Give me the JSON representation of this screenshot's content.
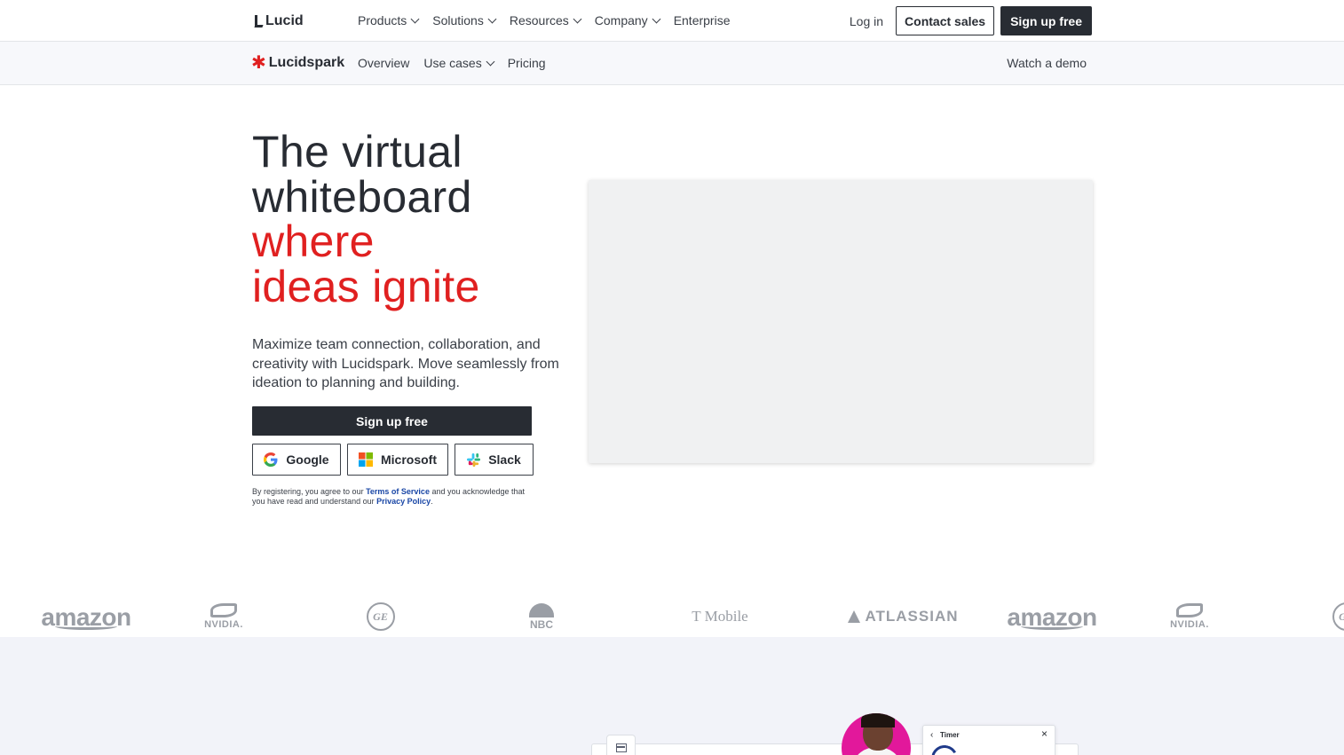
{
  "topnav": {
    "logo": "Lucid",
    "menu": [
      {
        "label": "Products",
        "dropdown": true
      },
      {
        "label": "Solutions",
        "dropdown": true
      },
      {
        "label": "Resources",
        "dropdown": true
      },
      {
        "label": "Company",
        "dropdown": true
      },
      {
        "label": "Enterprise",
        "dropdown": false
      }
    ],
    "login": "Log in",
    "contact_sales": "Contact sales",
    "signup": "Sign up free"
  },
  "subnav": {
    "logo": "Lucidspark",
    "items": [
      {
        "label": "Overview",
        "dropdown": false
      },
      {
        "label": "Use cases",
        "dropdown": true
      },
      {
        "label": "Pricing",
        "dropdown": false
      }
    ],
    "watch_demo": "Watch a demo"
  },
  "hero": {
    "title_line1": "The virtual",
    "title_line2": "whiteboard",
    "title_accent1": "where",
    "title_accent2": "ideas ignite",
    "accent_color": "#e02020",
    "description": "Maximize team connection, collaboration, and creativity with Lucidspark. Move seamlessly from ideation to planning and building.",
    "signup": "Sign up free",
    "sso": {
      "google": "Google",
      "microsoft": "Microsoft",
      "slack": "Slack"
    },
    "legal": {
      "part1": "By registering, you agree to our ",
      "terms": "Terms of Service",
      "part2": " and you acknowledge that you have read and understand our ",
      "privacy": "Privacy Policy",
      "part3": "."
    }
  },
  "logos": {
    "amazon": "amazon",
    "nvidia": "NVIDIA.",
    "ge": "GE",
    "nbc": "NBC",
    "tmobile": "T Mobile",
    "atlassian": "ATLASSIAN"
  },
  "timer": {
    "title": "Timer",
    "back": "‹",
    "close": "×"
  }
}
